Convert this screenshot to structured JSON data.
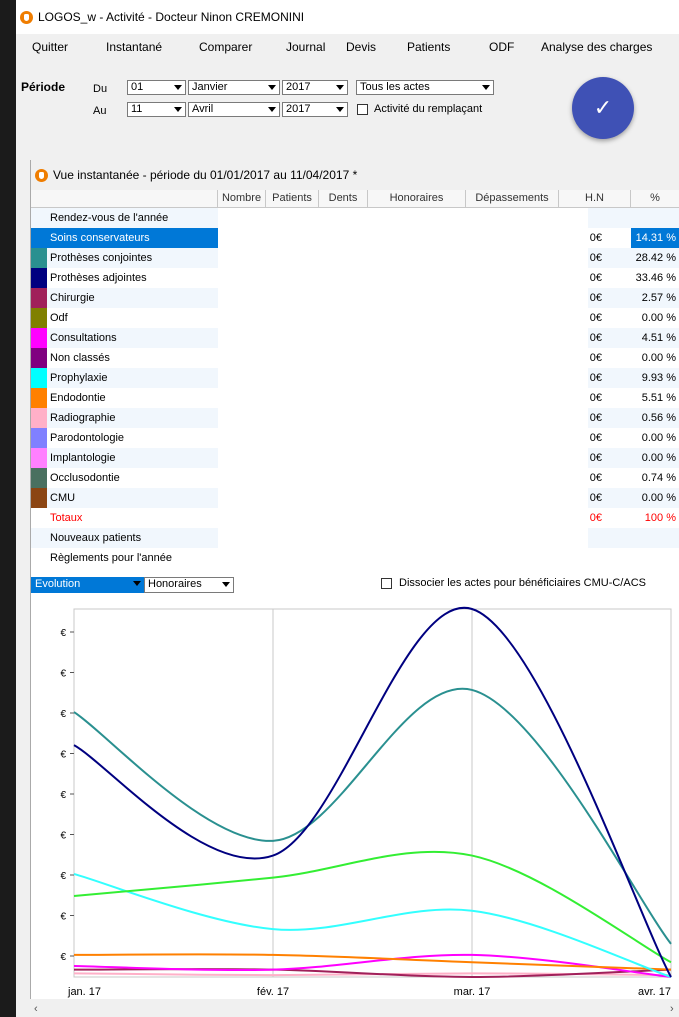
{
  "window": {
    "title": "LOGOS_w - Activité  - Docteur Ninon CREMONINI"
  },
  "menu": [
    "Quitter",
    "Instantané",
    "Comparer",
    "Journal",
    "Devis",
    "Patients",
    "ODF",
    "Analyse des charges"
  ],
  "periode": {
    "label": "Période",
    "du_label": "Du",
    "au_label": "Au",
    "du_day": "01",
    "du_month": "Janvier",
    "du_year": "2017",
    "au_day": "11",
    "au_month": "Avril",
    "au_year": "2017",
    "actes": "Tous les actes",
    "remplacant_label": "Activité du remplaçant",
    "validate_symbol": "✓"
  },
  "panel": {
    "title": "Vue instantanée - période du 01/01/2017 au 11/04/2017 *"
  },
  "table": {
    "columns": [
      "Nombre",
      "Patients",
      "Dents",
      "Honoraires",
      "Dépassements",
      "H.N",
      "%"
    ],
    "rows": [
      {
        "label": "Rendez-vous de l'année",
        "color": "",
        "euro": "",
        "pct": ""
      },
      {
        "label": "Soins conservateurs",
        "color": "#0078d7",
        "euro": "0€",
        "pct": "14.31 %",
        "selected": true
      },
      {
        "label": "Prothèses conjointes",
        "color": "#2a9090",
        "euro": "0€",
        "pct": "28.42 %"
      },
      {
        "label": "Prothèses adjointes",
        "color": "#000080",
        "euro": "0€",
        "pct": "33.46 %"
      },
      {
        "label": "Chirurgie",
        "color": "#a0205a",
        "euro": "0€",
        "pct": "2.57 %"
      },
      {
        "label": "Odf",
        "color": "#808000",
        "euro": "0€",
        "pct": "0.00 %"
      },
      {
        "label": "Consultations",
        "color": "#ff00ff",
        "euro": "0€",
        "pct": "4.51 %"
      },
      {
        "label": "Non classés",
        "color": "#800080",
        "euro": "0€",
        "pct": "0.00 %"
      },
      {
        "label": "Prophylaxie",
        "color": "#00ffff",
        "euro": "0€",
        "pct": "9.93 %"
      },
      {
        "label": "Endodontie",
        "color": "#ff8000",
        "euro": "0€",
        "pct": "5.51 %"
      },
      {
        "label": "Radiographie",
        "color": "#ffb0c8",
        "euro": "0€",
        "pct": "0.56 %"
      },
      {
        "label": "Parodontologie",
        "color": "#8080ff",
        "euro": "0€",
        "pct": "0.00 %"
      },
      {
        "label": "Implantologie",
        "color": "#ff80ff",
        "euro": "0€",
        "pct": "0.00 %"
      },
      {
        "label": "Occlusodontie",
        "color": "#4a7060",
        "euro": "0€",
        "pct": "0.74 %"
      },
      {
        "label": "CMU",
        "color": "#8b4513",
        "euro": "0€",
        "pct": "0.00 %"
      },
      {
        "label": "Totaux",
        "color": "",
        "euro": "0€",
        "pct": "100 %",
        "total": true
      },
      {
        "label": "Nouveaux patients",
        "color": "",
        "euro": "",
        "pct": ""
      },
      {
        "label": "Règlements pour l'année",
        "color": "",
        "euro": "",
        "pct": ""
      }
    ]
  },
  "chart_controls": {
    "mode": "Evolution",
    "metric": "Honoraires",
    "cmu_label": "Dissocier les actes pour bénéficiaires CMU-C/ACS"
  },
  "colors": {
    "accent": "#3f51b5",
    "selection": "#0078d7",
    "total": "#ff0000"
  },
  "chart_data": {
    "type": "line",
    "x": [
      "jan. 17",
      "fév. 17",
      "mar. 17",
      "avr. 17"
    ],
    "y_tick_labels": [
      "€",
      "€",
      "€",
      "€",
      "€",
      "€",
      "€",
      "€",
      "€"
    ],
    "grid": true,
    "series": [
      {
        "color": "#000080",
        "values": [
          63,
          33,
          100,
          0
        ]
      },
      {
        "color": "#2a9090",
        "values": [
          72,
          37,
          78,
          9
        ]
      },
      {
        "color": "#33ee33",
        "values": [
          22,
          27,
          33,
          4
        ]
      },
      {
        "color": "#33ffff",
        "values": [
          28,
          13,
          18,
          0
        ]
      },
      {
        "color": "#ff8000",
        "values": [
          6,
          6,
          4,
          2
        ]
      },
      {
        "color": "#ff00ff",
        "values": [
          3,
          2,
          6,
          0
        ]
      },
      {
        "color": "#a0205a",
        "values": [
          2,
          2,
          0,
          2
        ]
      },
      {
        "color": "#ffb0c8",
        "values": [
          1,
          0.5,
          1,
          0.5
        ]
      }
    ]
  }
}
